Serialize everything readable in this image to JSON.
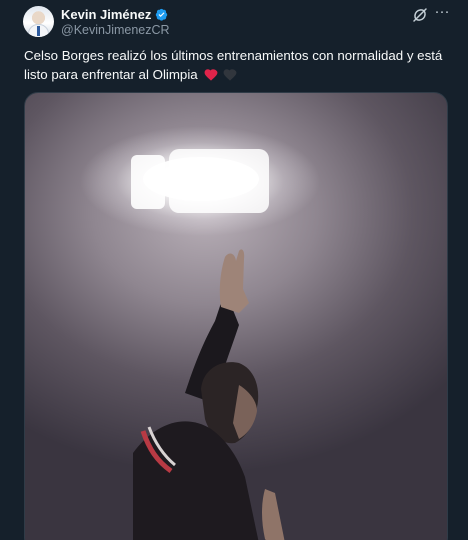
{
  "author": {
    "display_name": "Kevin Jiménez",
    "handle": "@KevinJimenezCR",
    "verified": true
  },
  "tweet": {
    "text": "Celso Borges realizó los últimos entrenamientos con normalidad y está listo para enfrentar al Olimpia",
    "emojis": [
      "red-heart",
      "black-heart"
    ]
  },
  "icons": {
    "actions": [
      "grok-icon",
      "more-options-icon"
    ]
  },
  "colors": {
    "background": "#15202b",
    "text": "#f7f9f9",
    "secondary_text": "#8b98a5",
    "verified_badge": "#1d9bf0",
    "heart": "#e0244a"
  }
}
